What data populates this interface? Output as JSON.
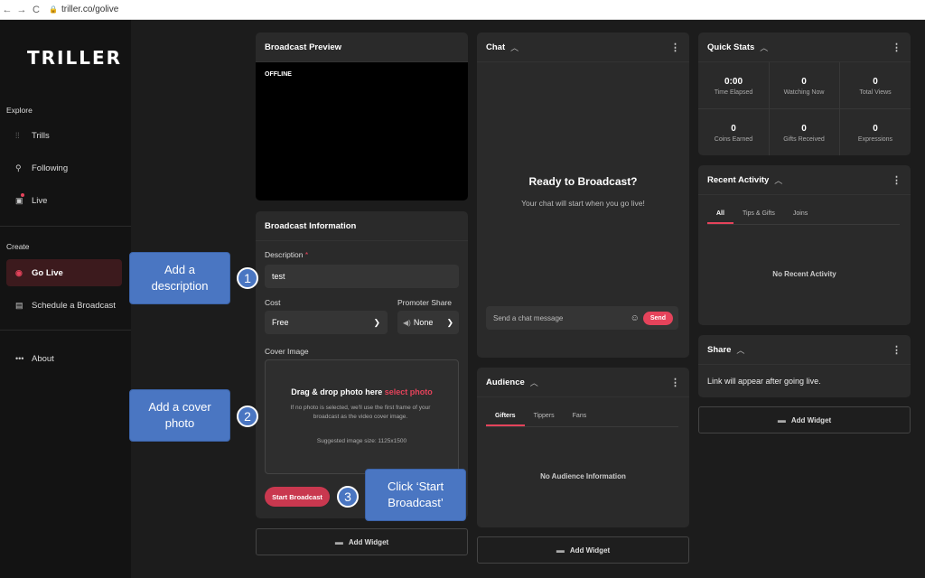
{
  "browser": {
    "back": "←",
    "forward": "→",
    "reload": "C",
    "lock": "🔒",
    "url": "triller.co/golive"
  },
  "sidebar": {
    "logo": "TRILLER",
    "explore_label": "Explore",
    "create_label": "Create",
    "items": [
      {
        "label": "Trills",
        "icon": "trills-icon"
      },
      {
        "label": "Following",
        "icon": "following-icon"
      },
      {
        "label": "Live",
        "icon": "live-icon"
      },
      {
        "label": "Go Live",
        "icon": "go-live-icon"
      },
      {
        "label": "Schedule a Broadcast",
        "icon": "calendar-icon"
      },
      {
        "label": "About",
        "icon": "more-icon"
      }
    ]
  },
  "preview": {
    "title": "Broadcast Preview",
    "status": "OFFLINE"
  },
  "info": {
    "title": "Broadcast Information",
    "description_label": "Description",
    "required_mark": "*",
    "description_value": "test",
    "cost_label": "Cost",
    "cost_value": "Free",
    "promoter_label": "Promoter Share",
    "promoter_value": "None",
    "cover_label": "Cover Image",
    "dropzone_title": "Drag & drop photo here",
    "dropzone_link": "select photo",
    "dropzone_note": "If no photo is selected, we'll use the first frame of your broadcast as the video cover image.",
    "dropzone_size": "Suggested image size: 1125x1500",
    "start_button": "Start Broadcast"
  },
  "add_widget": "Add Widget",
  "chat": {
    "title": "Chat",
    "ready": "Ready to Broadcast?",
    "sub": "Your chat will start when you go live!",
    "placeholder": "Send a chat message",
    "send": "Send"
  },
  "audience": {
    "title": "Audience",
    "tabs": [
      "Gifters",
      "Tippers",
      "Fans"
    ],
    "empty": "No Audience Information"
  },
  "quick_stats": {
    "title": "Quick Stats",
    "stats": [
      {
        "value": "0:00",
        "label": "Time Elapsed"
      },
      {
        "value": "0",
        "label": "Watching Now"
      },
      {
        "value": "0",
        "label": "Total Views"
      },
      {
        "value": "0",
        "label": "Coins Earned"
      },
      {
        "value": "0",
        "label": "Gifts Received"
      },
      {
        "value": "0",
        "label": "Expressions"
      }
    ]
  },
  "recent": {
    "title": "Recent Activity",
    "tabs": [
      "All",
      "Tips & Gifts",
      "Joins"
    ],
    "empty": "No Recent Activity"
  },
  "share": {
    "title": "Share",
    "text": "Link will appear after going live."
  },
  "callouts": [
    {
      "num": "1",
      "text": "Add a description"
    },
    {
      "num": "2",
      "text": "Add a cover photo"
    },
    {
      "num": "3",
      "text": "Click ‘Start Broadcast’"
    }
  ],
  "colors": {
    "accent": "#e5435b",
    "callout": "#4a76c2",
    "background": "#1c1c1c",
    "panel": "#2a2a2a"
  }
}
